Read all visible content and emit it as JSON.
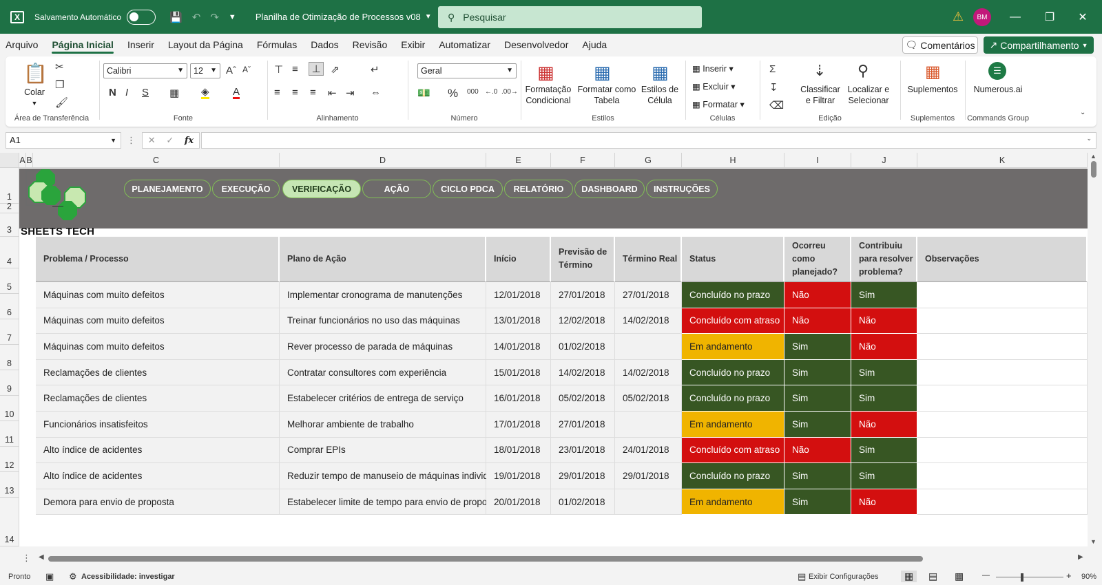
{
  "titlebar": {
    "autosave_label": "Salvamento Automático",
    "doc_title": "Planilha de Otimização de Processos v08",
    "search_placeholder": "Pesquisar",
    "avatar_initials": "BM"
  },
  "menu": [
    "Arquivo",
    "Página Inicial",
    "Inserir",
    "Layout da Página",
    "Fórmulas",
    "Dados",
    "Revisão",
    "Exibir",
    "Automatizar",
    "Desenvolvedor",
    "Ajuda"
  ],
  "menu_active": "Página Inicial",
  "comments_label": "Comentários",
  "share_label": "Compartilhamento",
  "ribbon": {
    "clipboard": {
      "paste": "Colar",
      "label": "Área de Transferência"
    },
    "font": {
      "name": "Calibri",
      "size": "12",
      "label": "Fonte",
      "bold": "N",
      "italic": "I",
      "underline": "S"
    },
    "alignment": {
      "label": "Alinhamento"
    },
    "number": {
      "format": "Geral",
      "label": "Número"
    },
    "styles": {
      "cond_format": "Formatação Condicional",
      "format_table": "Formatar como Tabela",
      "cell_styles": "Estilos de Célula",
      "label": "Estilos"
    },
    "cells": {
      "insert": "Inserir",
      "delete": "Excluir",
      "format": "Formatar",
      "label": "Células"
    },
    "editing": {
      "sort": "Classificar e Filtrar",
      "find": "Localizar e Selecionar",
      "label": "Edição"
    },
    "addins": {
      "btn": "Suplementos",
      "label": "Suplementos"
    },
    "commands": {
      "btn": "Numerous.ai",
      "label": "Commands Group"
    }
  },
  "formula": {
    "namebox": "A1",
    "fx": "fx"
  },
  "columns": [
    "A",
    "B",
    "C",
    "D",
    "E",
    "F",
    "G",
    "H",
    "I",
    "J",
    "K"
  ],
  "rows": [
    "1",
    "2",
    "3",
    "4",
    "5",
    "6",
    "7",
    "8",
    "9",
    "10",
    "11",
    "12",
    "13",
    "14"
  ],
  "nav": [
    "PLANEJAMENTO",
    "EXECUÇÃO",
    "VERIFICAÇÃO",
    "AÇÃO",
    "CICLO PDCA",
    "RELATÓRIO",
    "DASHBOARD",
    "INSTRUÇÕES"
  ],
  "nav_active": "VERIFICAÇÃO",
  "brand": "SHEETS TECH",
  "colors": {
    "ok": "#375623",
    "late": "#d30f0f",
    "progress": "#f0b400",
    "brand_green": "#1e7145"
  },
  "table": {
    "headers": [
      "Problema / Processo",
      "Plano de Ação",
      "Início",
      "Previsão de Término",
      "Término Real",
      "Status",
      "Ocorreu como planejado?",
      "Contribuiu para resolver problema?",
      "Observações"
    ],
    "rows": [
      [
        "Máquinas com muito defeitos",
        "Implementar cronograma de manutenções",
        "12/01/2018",
        "27/01/2018",
        "27/01/2018",
        "Concluído no prazo",
        "Não",
        "Sim",
        ""
      ],
      [
        "Máquinas com muito defeitos",
        "Treinar funcionários no uso das máquinas",
        "13/01/2018",
        "12/02/2018",
        "14/02/2018",
        "Concluído com atraso",
        "Não",
        "Não",
        ""
      ],
      [
        "Máquinas com muito defeitos",
        "Rever processo de parada de máquinas",
        "14/01/2018",
        "01/02/2018",
        "",
        "Em andamento",
        "Sim",
        "Não",
        ""
      ],
      [
        "Reclamações de clientes",
        "Contratar consultores com experiência",
        "15/01/2018",
        "14/02/2018",
        "14/02/2018",
        "Concluído no prazo",
        "Sim",
        "Sim",
        ""
      ],
      [
        "Reclamações de clientes",
        "Estabelecer critérios de entrega de serviço",
        "16/01/2018",
        "05/02/2018",
        "05/02/2018",
        "Concluído no prazo",
        "Sim",
        "Sim",
        ""
      ],
      [
        "Funcionários insatisfeitos",
        "Melhorar ambiente de trabalho",
        "17/01/2018",
        "27/01/2018",
        "",
        "Em andamento",
        "Sim",
        "Não",
        ""
      ],
      [
        "Alto índice de acidentes",
        "Comprar EPIs",
        "18/01/2018",
        "23/01/2018",
        "24/01/2018",
        "Concluído com atraso",
        "Não",
        "Sim",
        ""
      ],
      [
        "Alto índice de acidentes",
        "Reduzir tempo de manuseio de máquinas individual",
        "19/01/2018",
        "29/01/2018",
        "29/01/2018",
        "Concluído no prazo",
        "Sim",
        "Sim",
        ""
      ],
      [
        "Demora para envio de proposta",
        "Estabelecer limite de tempo para envio de proposta",
        "20/01/2018",
        "01/02/2018",
        "",
        "Em andamento",
        "Sim",
        "Não",
        ""
      ]
    ]
  },
  "status": {
    "ready": "Pronto",
    "accessibility": "Acessibilidade: investigar",
    "view_settings": "Exibir Configurações",
    "zoom": "90%"
  }
}
